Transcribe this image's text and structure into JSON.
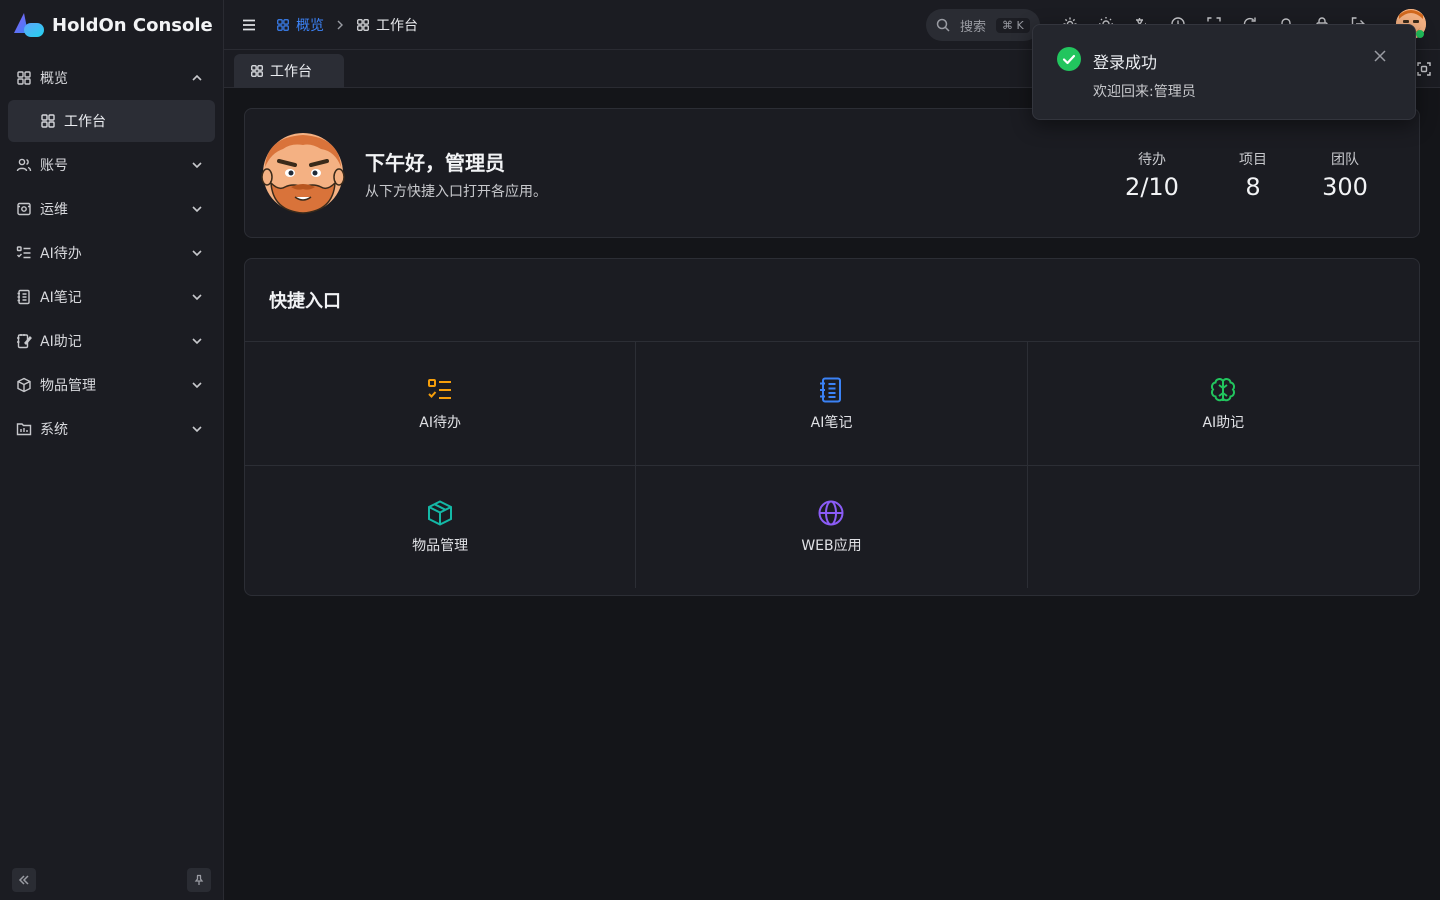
{
  "brand": {
    "name": "HoldOn Console",
    "logo_icon": "brand-logo-icon"
  },
  "colors": {
    "accent": "#3b82f6",
    "success": "#22c55e",
    "orange": "#f59e0b",
    "teal": "#14b8a6",
    "purple": "#8b5cf6",
    "green": "#22c55e"
  },
  "sidebar": {
    "items": [
      {
        "label": "概览",
        "icon": "grid-icon",
        "expanded": true
      },
      {
        "label": "账号",
        "icon": "users-icon"
      },
      {
        "label": "运维",
        "icon": "ops-icon"
      },
      {
        "label": "AI待办",
        "icon": "todo-list-icon"
      },
      {
        "label": "AI笔记",
        "icon": "notebook-icon"
      },
      {
        "label": "AI助记",
        "icon": "note-edit-icon"
      },
      {
        "label": "物品管理",
        "icon": "box-icon"
      },
      {
        "label": "系统",
        "icon": "folder-icon"
      }
    ],
    "sub_items": [
      {
        "label": "工作台",
        "icon": "grid-icon"
      }
    ]
  },
  "header": {
    "breadcrumb": [
      {
        "label": "概览"
      },
      {
        "label": "工作台"
      }
    ],
    "search": {
      "placeholder": "搜索",
      "shortcut": "⌘ K"
    }
  },
  "tabs": [
    {
      "label": "工作台"
    }
  ],
  "greeting": {
    "title": "下午好，管理员",
    "subtitle": "从下方快捷入口打开各应用。",
    "stats": [
      {
        "label": "待办",
        "value": "2/10"
      },
      {
        "label": "项目",
        "value": "8"
      },
      {
        "label": "团队",
        "value": "300"
      }
    ]
  },
  "quick": {
    "title": "快捷入口",
    "items": [
      {
        "label": "AI待办",
        "icon": "todo-list-icon",
        "color": "#f59e0b"
      },
      {
        "label": "AI笔记",
        "icon": "notebook-icon",
        "color": "#3b82f6"
      },
      {
        "label": "AI助记",
        "icon": "brain-icon",
        "color": "#22c55e"
      },
      {
        "label": "物品管理",
        "icon": "box-icon",
        "color": "#14b8a6"
      },
      {
        "label": "WEB应用",
        "icon": "globe-icon",
        "color": "#8b5cf6"
      }
    ]
  },
  "toast": {
    "title": "登录成功",
    "message": "欢迎回来:管理员"
  }
}
